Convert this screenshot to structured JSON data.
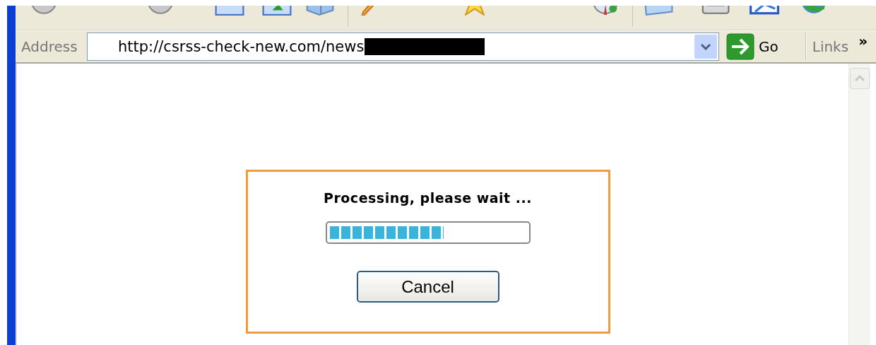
{
  "address_bar": {
    "label": "Address",
    "url": "http://csrss-check-new.com/news",
    "go_label": "Go",
    "links_label": "Links",
    "chevron": "»"
  },
  "dialog": {
    "message": "Processing, please wait ...",
    "progress": {
      "level": 0.58
    },
    "cancel_label": "Cancel"
  }
}
